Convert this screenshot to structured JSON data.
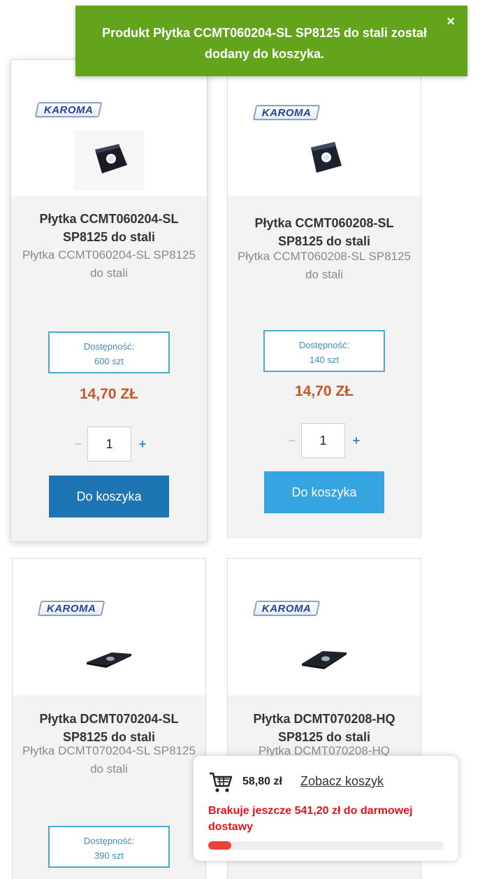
{
  "notification": {
    "message": "Produkt Płytka CCMT060204-SL SP8125 do stali został dodany do koszyka.",
    "close_glyph": "×"
  },
  "products": [
    {
      "brand": "KAROMA",
      "title": "Płytka CCMT060204-SL SP8125 do stali",
      "subtitle": "Płytka CCMT060204-SL SP8125 do stali",
      "availability_label": "Dostępność:",
      "availability_value": "600 szt",
      "price": "14,70 ZŁ",
      "qty_minus": "−",
      "qty_value": "1",
      "qty_plus": "+",
      "button_label": "Do koszyka"
    },
    {
      "brand": "KAROMA",
      "title": "Płytka CCMT060208-SL SP8125 do stali",
      "subtitle": "Płytka CCMT060208-SL SP8125 do stali",
      "availability_label": "Dostępność:",
      "availability_value": "140 szt",
      "price": "14,70 ZŁ",
      "qty_minus": "−",
      "qty_value": "1",
      "qty_plus": "+",
      "button_label": "Do koszyka"
    },
    {
      "brand": "KAROMA",
      "title": "Płytka DCMT070204-SL SP8125 do stali",
      "subtitle": "Płytka DCMT070204-SL SP8125 do stali",
      "availability_label": "Dostępność:",
      "availability_value": "390 szt"
    },
    {
      "brand": "KAROMA",
      "title": "Płytka DCMT070208-HQ SP8125 do stali",
      "subtitle": "Płytka DCMT070208-HQ"
    }
  ],
  "mini_cart": {
    "icon": "shopping-cart-icon",
    "total": "58,80 zł",
    "link_label": "Zobacz koszyk",
    "missing_text": "Brakuje jeszcze 541,20 zł do darmowej dostawy",
    "progress_fraction": 0.098
  },
  "colors": {
    "notification_bg": "#63a41c",
    "price": "#c8542c",
    "button_dark": "#1d75b3",
    "button_light": "#36a4e0",
    "availability_border": "#4aa8d6",
    "missing_text": "#e3121b",
    "progress_fill": "#e8423b"
  }
}
